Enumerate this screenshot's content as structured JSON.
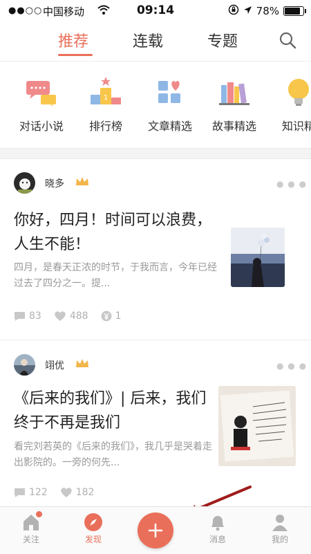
{
  "status_bar": {
    "signal": "●●○○",
    "carrier": "中国移动",
    "time": "09:14",
    "battery": "78%",
    "battery_level": 0.78
  },
  "top_nav": {
    "tabs": [
      {
        "label": "推荐",
        "active": true
      },
      {
        "label": "连载",
        "active": false
      },
      {
        "label": "专题",
        "active": false
      }
    ],
    "search_icon": "search-icon"
  },
  "categories": [
    {
      "label": "对话小说",
      "icon": "chat-bubbles-icon"
    },
    {
      "label": "排行榜",
      "icon": "podium-icon"
    },
    {
      "label": "文章精选",
      "icon": "grid-heart-icon"
    },
    {
      "label": "故事精选",
      "icon": "books-icon"
    },
    {
      "label": "知识精",
      "icon": "lightbulb-icon"
    }
  ],
  "articles": [
    {
      "author": "晓多",
      "title": "你好，四月！时间可以浪费，人生不能！",
      "summary": "四月，是春天正浓的时节，于我而言，今年已经过去了四分之一。提...",
      "comments": "83",
      "likes": "488",
      "rewards": "1"
    },
    {
      "author": "翊优",
      "title": "《后来的我们》| 后来，我们终于不再是我们",
      "summary": "看完刘若英的《后来的我们》，我几乎是哭着走出影院的。一旁的何先...",
      "comments": "122",
      "likes": "182"
    }
  ],
  "tab_bar": {
    "items": [
      {
        "label": "关注",
        "icon": "home-icon"
      },
      {
        "label": "发现",
        "icon": "compass-icon",
        "active": true
      },
      {
        "label": "消息",
        "icon": "bell-icon"
      },
      {
        "label": "我的",
        "icon": "person-icon"
      }
    ]
  },
  "colors": {
    "accent": "#ea6f5a",
    "text": "#333333",
    "muted": "#999999"
  }
}
